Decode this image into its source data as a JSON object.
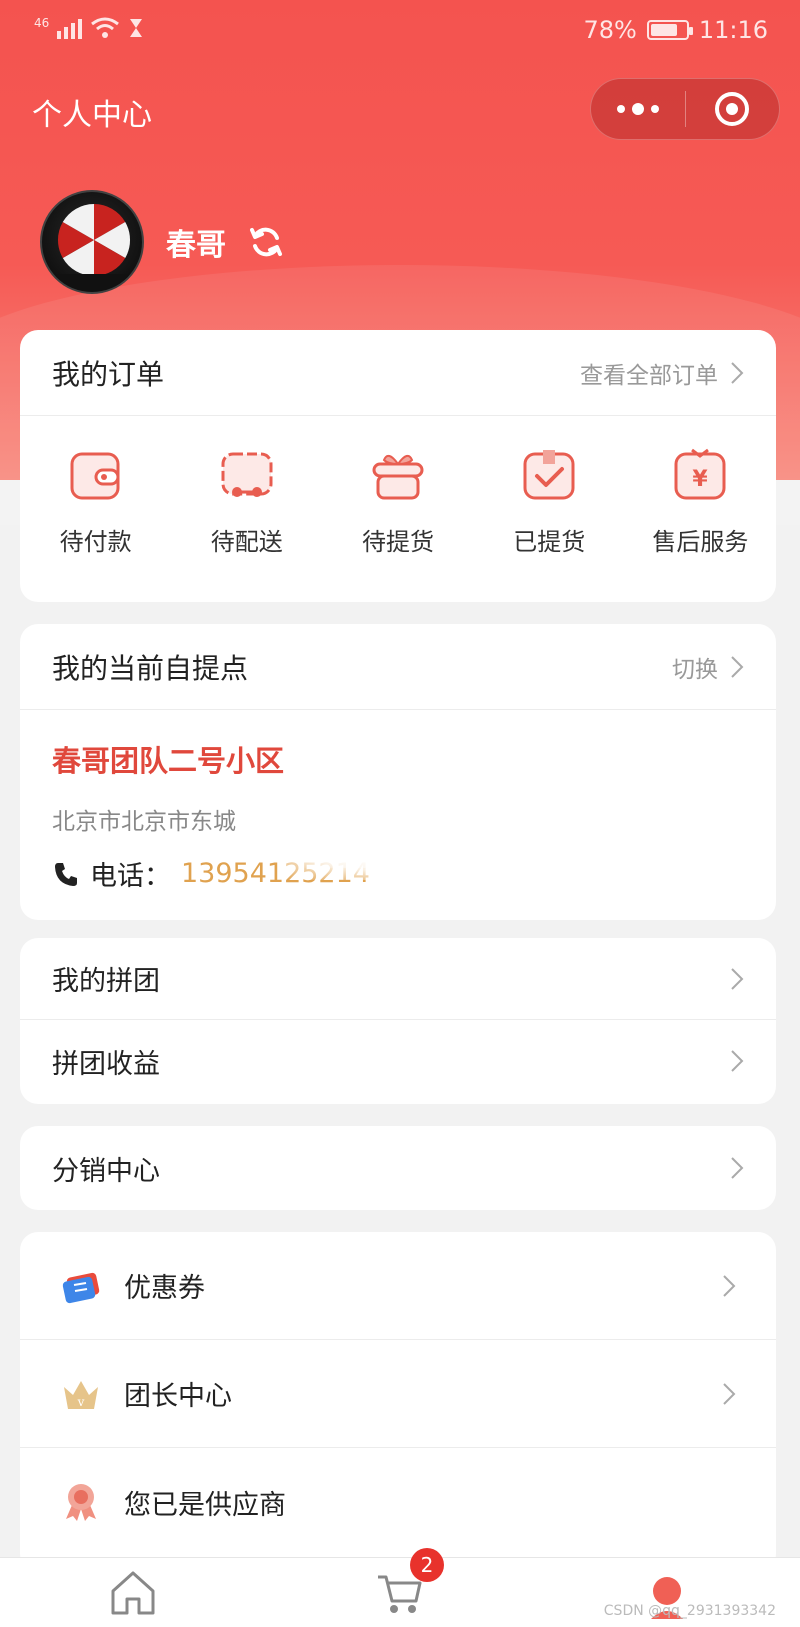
{
  "status_bar": {
    "network": "46",
    "battery": "78%",
    "battery_level": 0.78,
    "time": "11:16"
  },
  "nav": {
    "title": "个人中心"
  },
  "profile": {
    "username": "春哥"
  },
  "orders": {
    "title": "我的订单",
    "view_all": "查看全部订单",
    "items": [
      {
        "label": "待付款",
        "icon": "wallet-icon"
      },
      {
        "label": "待配送",
        "icon": "delivery-truck-icon"
      },
      {
        "label": "待提货",
        "icon": "gift-box-icon"
      },
      {
        "label": "已提货",
        "icon": "picked-up-check-icon"
      },
      {
        "label": "售后服务",
        "icon": "after-sales-yen-icon"
      }
    ]
  },
  "station": {
    "title": "我的当前自提点",
    "switch_label": "切换",
    "name": "春哥团队二号小区",
    "address": "北京市北京市东城",
    "phone_label": "电话：",
    "phone": "13954125214"
  },
  "group": {
    "items": [
      {
        "label": "我的拼团"
      },
      {
        "label": "拼团收益"
      }
    ]
  },
  "distribution": {
    "label": "分销中心"
  },
  "extras": {
    "items": [
      {
        "label": "优惠券",
        "icon": "coupon-icon"
      },
      {
        "label": "团长中心",
        "icon": "crown-icon"
      },
      {
        "label": "您已是供应商",
        "icon": "medal-ribbon-icon"
      }
    ]
  },
  "tabbar": {
    "cart_badge": "2",
    "active": "profile"
  },
  "watermark": "CSDN @qq_2931393342",
  "colors": {
    "brand_red": "#f4534f",
    "station_name": "#e0483c",
    "phone": "#e0a24f",
    "badge": "#e8322c"
  }
}
